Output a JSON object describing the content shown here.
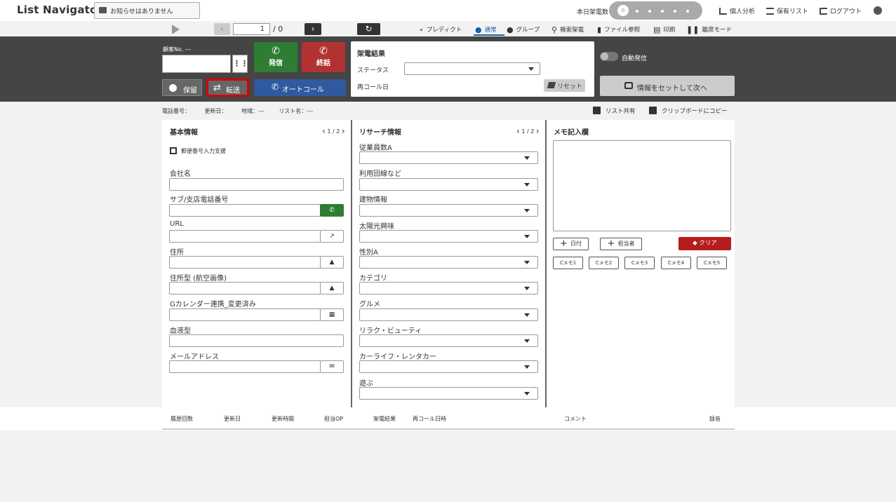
{
  "header": {
    "logo": "List Navigator.",
    "notice": "お知らせはありません",
    "call_count_label": "本日架電数",
    "call_count_value": "0",
    "links": [
      "個人分析",
      "保有リスト",
      "ログアウト"
    ]
  },
  "toolbar": {
    "page_input": "1",
    "page_total": "/ 0",
    "nav": {
      "predict": "プレディクト",
      "normal": "通常",
      "group": "グループ",
      "search_call": "検索架電",
      "file_ref": "ファイル参照",
      "print": "印刷",
      "leave_mode": "離席モード"
    }
  },
  "call_panel": {
    "customer_no_label": "顧客No. ---",
    "dial_label": "発信",
    "hangup_label": "終話",
    "hold_label": "保留",
    "transfer_label": "転送",
    "autocall_label": "オートコール",
    "result_title": "架電結果",
    "status_label": "ステータス",
    "recall_label": "再コール日",
    "reset_label": "リセット",
    "auto_dial_label": "自動発信",
    "set_next_label": "情報をセットして次へ"
  },
  "info_row": {
    "phone": "電話番号：",
    "updated": "更新日：",
    "region": "地域：---",
    "list_name": "リスト名：---",
    "share": "リスト共有",
    "copy": "クリップボードにコピー"
  },
  "basic": {
    "title": "基本情報",
    "pager": "1 / 2",
    "zip_helper": "郵便番号入力支援",
    "fields": [
      "会社名",
      "サブ/支店電話番号",
      "URL",
      "住所",
      "住所型 (航空画像)",
      "Gカレンダー連携_変更済み",
      "血液型",
      "メールアドレス"
    ]
  },
  "research": {
    "title": "リサーチ情報",
    "pager": "1 / 2",
    "fields": [
      "従業員数A",
      "利用回線など",
      "建物情報",
      "太陽光興味",
      "性別A",
      "カテゴリ",
      "グルメ",
      "リラク・ビューティ",
      "カーライフ・レンタカー",
      "遊ぶ"
    ]
  },
  "memo": {
    "title": "メモ記入欄",
    "date_btn": "日付",
    "person_btn": "担当者",
    "clear_btn": "クリア",
    "cmemos": [
      "Cメモ1",
      "Cメモ2",
      "Cメモ3",
      "Cメモ4",
      "Cメモ5"
    ]
  },
  "history": {
    "columns": [
      "履歴回数",
      "更新日",
      "更新時間",
      "担当OP",
      "架電結果",
      "再コール日時",
      "コメント",
      "録音"
    ]
  },
  "colors": {
    "dial_green": "#2e7d32",
    "hangup_red": "#b23232",
    "autocall_blue": "#2f5aa0",
    "transfer_highlight": "#d40000",
    "clear_red": "#b71c1c"
  }
}
